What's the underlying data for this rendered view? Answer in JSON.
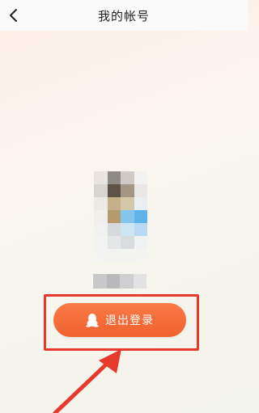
{
  "header": {
    "title": "我的帐号"
  },
  "icons": {
    "back": "chevron-left-icon",
    "qq": "qq-penguin-icon"
  },
  "logout": {
    "label": "退出登录"
  },
  "colors": {
    "button": "#f26a35",
    "highlight": "#e63a2c",
    "arrow": "#e63a2c"
  },
  "avatar": {
    "pixels": [
      "#e8e4e2",
      "#8e8a86",
      "#cfcac6",
      "#f2f2f0",
      "#d8d4cf",
      "#5e5248",
      "#a39685",
      "#e9e8e6",
      "#ece9e4",
      "#c6b08a",
      "#d4c6a9",
      "#e8eef2",
      "#f0efec",
      "#b59b6c",
      "#82c6ee",
      "#5fb3e9",
      "#f1f1ef",
      "#d7d9dc",
      "#cde6f3",
      "#b9daf0",
      "#f3f3f1",
      "#e4e6e8",
      "#d9dcdf",
      "#f0f1f2",
      "#f4f4f2",
      "#f3f3f2",
      "#f3f3f2",
      "#f4f4f3"
    ]
  },
  "username_blur": {
    "pixels": [
      "#c8c8ca",
      "#b9b9bc",
      "#cfcfd2",
      "#e2e2e4"
    ]
  }
}
